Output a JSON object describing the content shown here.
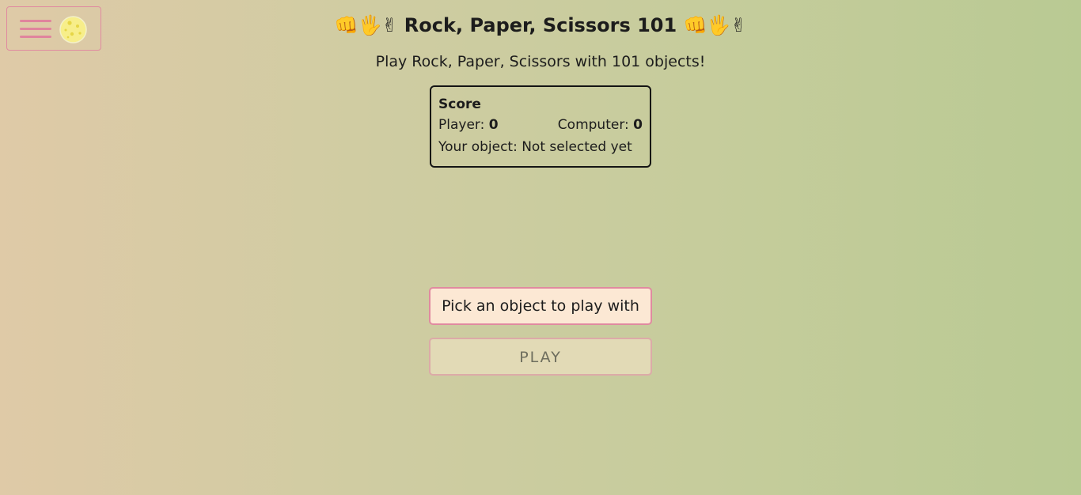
{
  "header": {
    "title": "👊🖐✌ Rock, Paper, Scissors 101 👊🖐✌",
    "subtitle": "Play Rock, Paper, Scissors with 101 objects!"
  },
  "nav": {
    "menu_icon": "hamburger-menu-icon",
    "theme_icon": "moon-icon"
  },
  "score": {
    "title": "Score",
    "player_label": "Player:",
    "player_value": "0",
    "computer_label": "Computer:",
    "computer_value": "0",
    "object_label": "Your object:",
    "object_value": "Not selected yet"
  },
  "controls": {
    "select_label": "Pick an object to play with",
    "play_label": "PLAY"
  },
  "colors": {
    "accent": "#e0849d",
    "select_bg": "#fce8d4",
    "play_bg": "#e2dab6",
    "moon": "#f7ee8a"
  }
}
